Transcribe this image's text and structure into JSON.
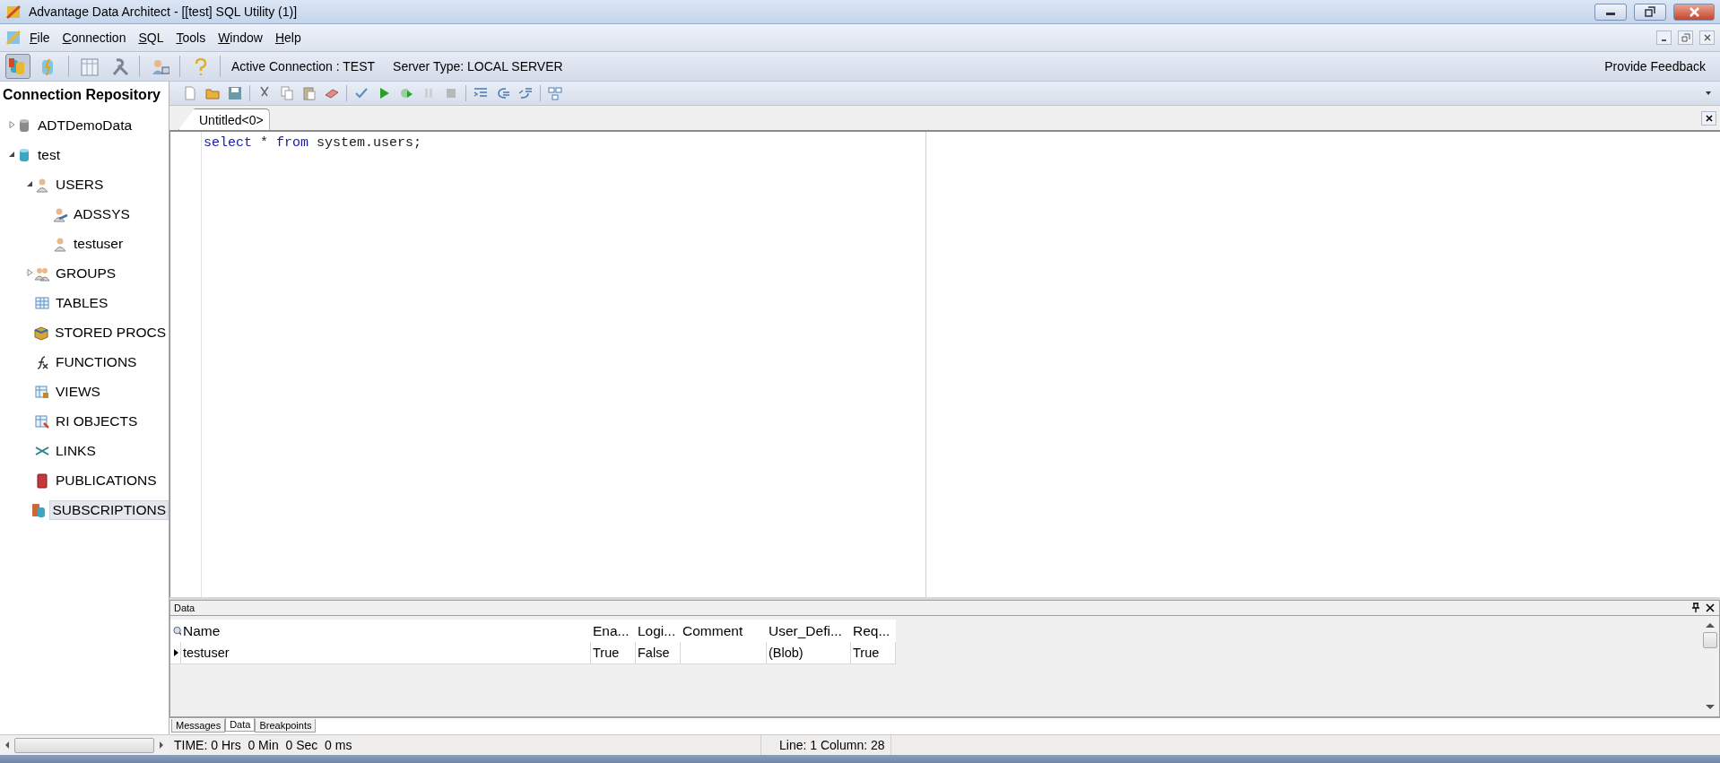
{
  "window": {
    "title": "Advantage Data Architect - [[test] SQL Utility (1)]"
  },
  "menu": [
    "File",
    "Connection",
    "SQL",
    "Tools",
    "Window",
    "Help"
  ],
  "toolbar": {
    "active_connection": "Active Connection : TEST",
    "server_type": "Server Type: LOCAL SERVER",
    "feedback": "Provide Feedback"
  },
  "sidebar": {
    "title": "Connection Repository",
    "tree": [
      {
        "label": "ADTDemoData",
        "kind": "db-grey",
        "expanded": false,
        "selected": false
      },
      {
        "label": "test",
        "kind": "db-cyan",
        "expanded": true,
        "selected": false,
        "children": [
          {
            "label": "USERS",
            "kind": "user",
            "expanded": true,
            "selected": false,
            "children": [
              {
                "label": "ADSSYS",
                "kind": "admin",
                "selected": false
              },
              {
                "label": "testuser",
                "kind": "user",
                "selected": false
              }
            ]
          },
          {
            "label": "GROUPS",
            "kind": "group",
            "expanded": false,
            "selected": false
          },
          {
            "label": "TABLES",
            "kind": "table",
            "selected": false
          },
          {
            "label": "STORED PROCS",
            "kind": "box",
            "selected": false
          },
          {
            "label": "FUNCTIONS",
            "kind": "function",
            "selected": false
          },
          {
            "label": "VIEWS",
            "kind": "view",
            "selected": false
          },
          {
            "label": "RI OBJECTS",
            "kind": "ri",
            "selected": false
          },
          {
            "label": "LINKS",
            "kind": "link",
            "selected": false
          },
          {
            "label": "PUBLICATIONS",
            "kind": "book",
            "selected": false
          },
          {
            "label": "SUBSCRIPTIONS",
            "kind": "subscription",
            "selected": true
          }
        ]
      }
    ]
  },
  "editor": {
    "tabs": [
      {
        "label": "Untitled<0>",
        "selected": true
      }
    ],
    "code": [
      {
        "kind": "keyword",
        "text": "select"
      },
      {
        "kind": "plain",
        "text": " * "
      },
      {
        "kind": "keyword",
        "text": "from"
      },
      {
        "kind": "plain",
        "text": " system.users;"
      }
    ]
  },
  "data_panel": {
    "title": "Data",
    "columns": [
      "Name",
      "Ena...",
      "Logi...",
      "Comment",
      "User_Defi...",
      "Req..."
    ],
    "rows": [
      [
        "testuser",
        "True",
        "False",
        "",
        "(Blob)",
        "True"
      ]
    ],
    "tabs": [
      {
        "label": "Messages",
        "selected": false
      },
      {
        "label": "Data",
        "selected": true
      },
      {
        "label": "Breakpoints",
        "selected": false
      }
    ]
  },
  "status_bar": {
    "time": "TIME: 0 Hrs  0 Min  0 Sec  0 ms",
    "position": "Line: 1 Column: 28"
  }
}
